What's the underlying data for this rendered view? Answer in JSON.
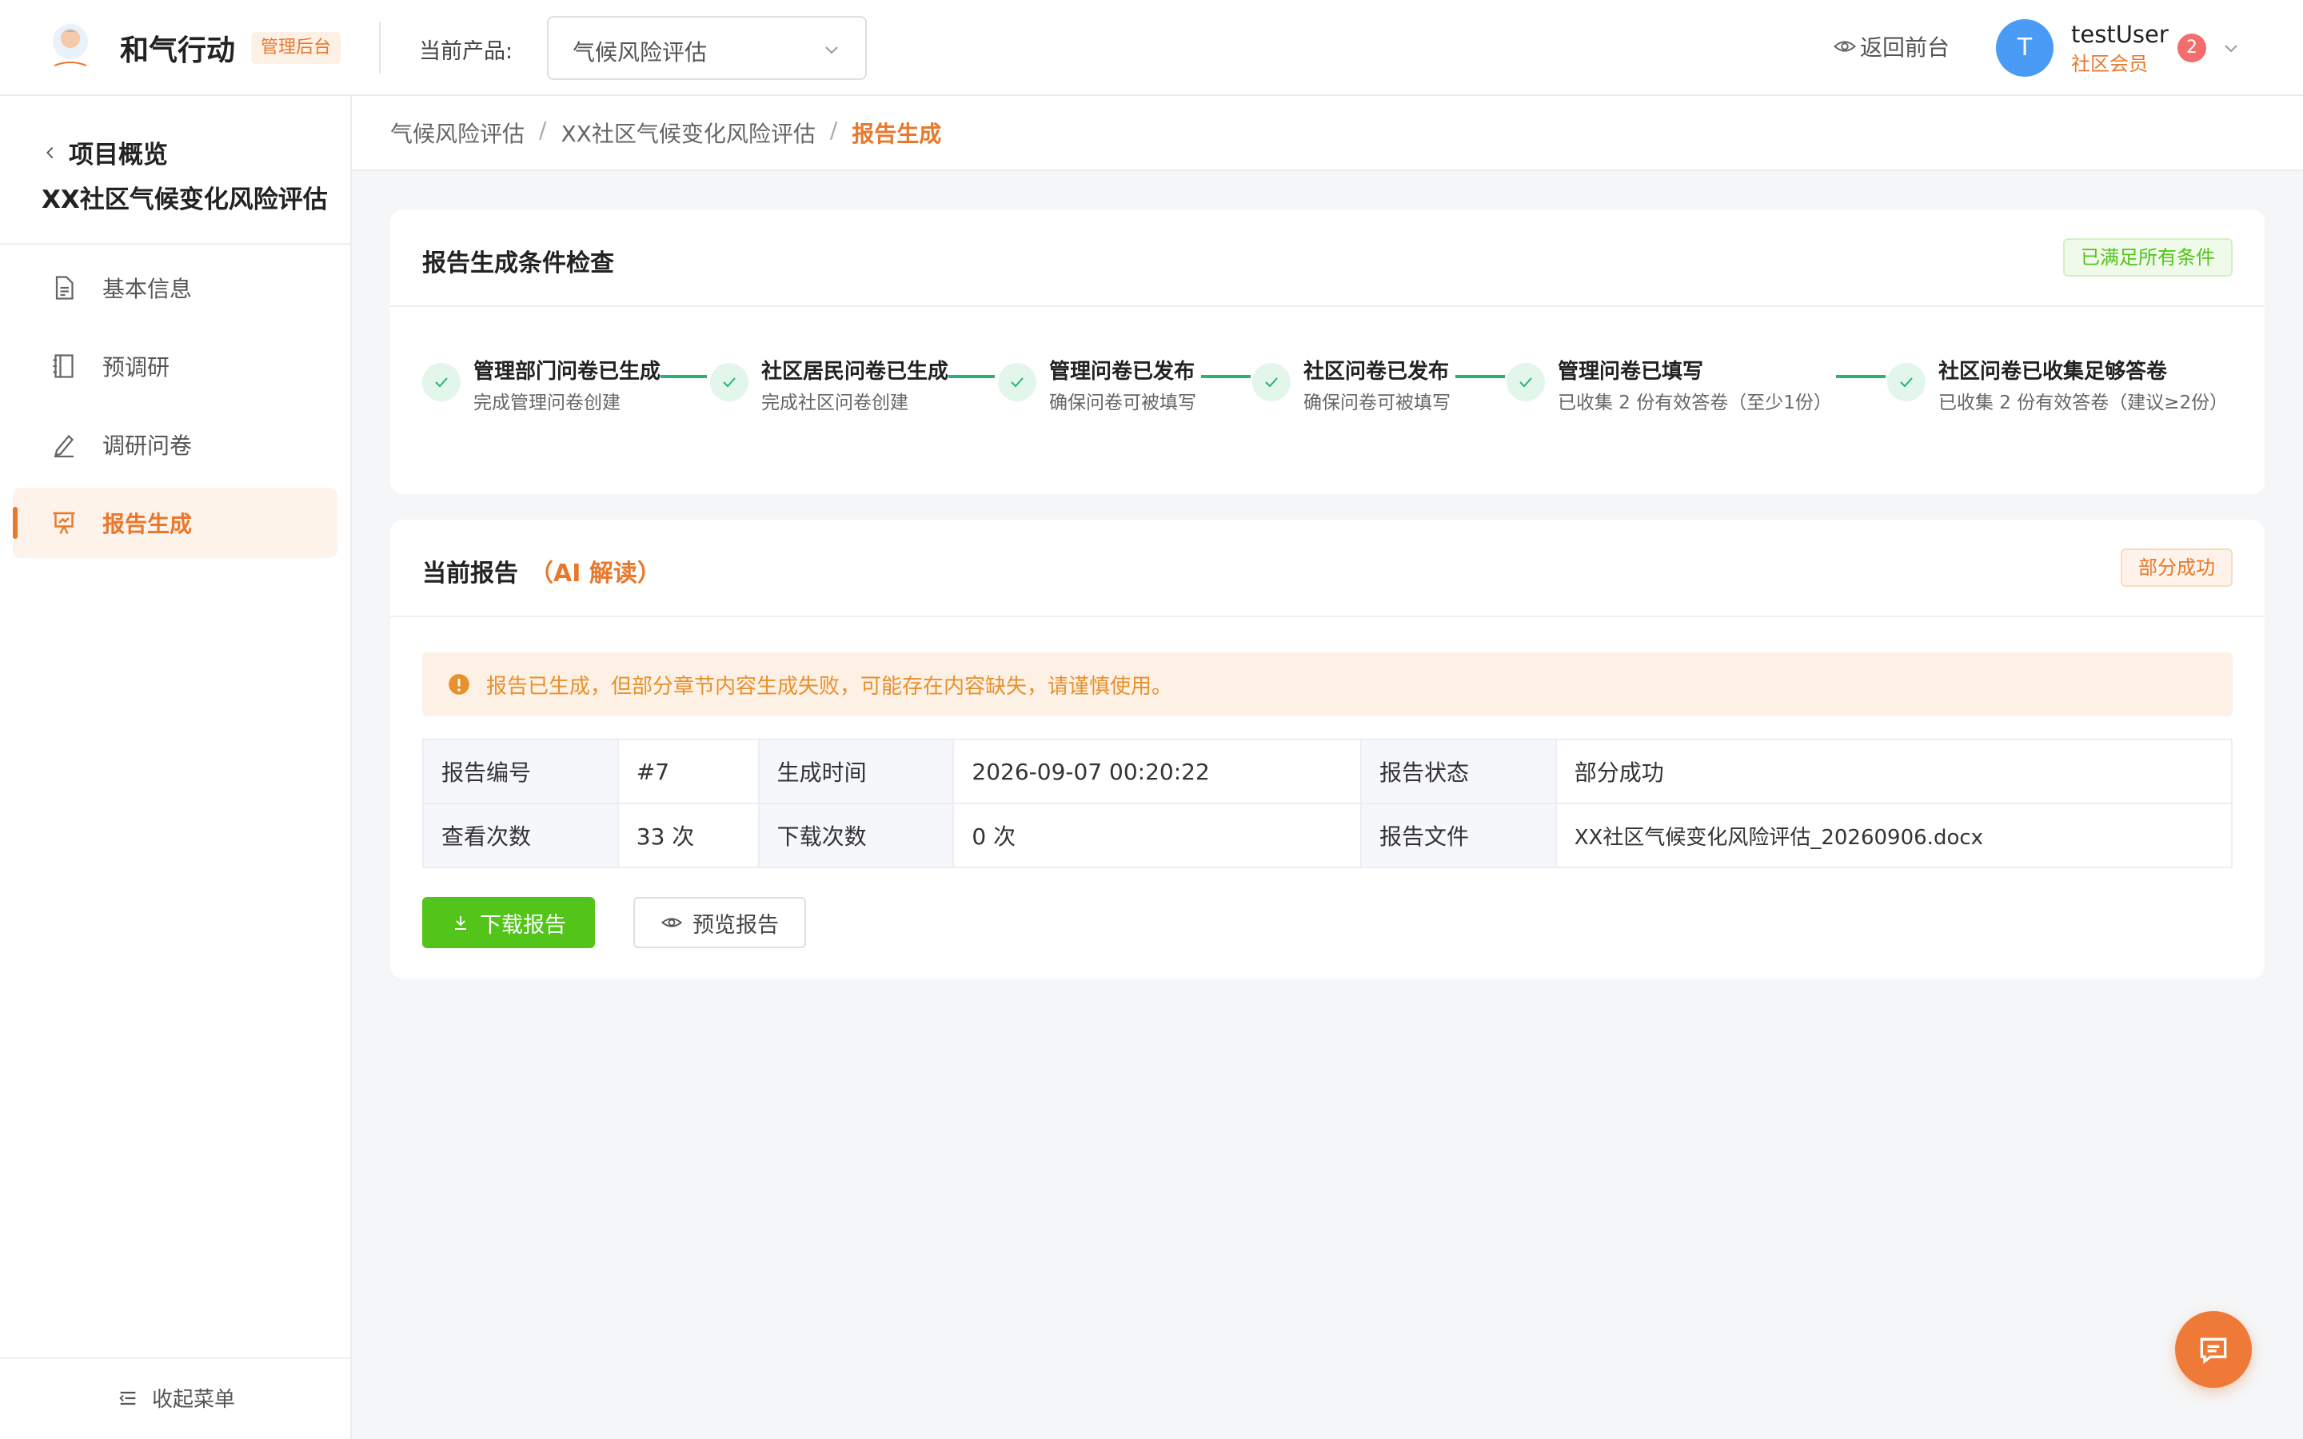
{
  "header": {
    "brand": "和气行动",
    "brand_tag": "管理后台",
    "product_label": "当前产品:",
    "product_value": "气候风险评估",
    "back_front": "返回前台",
    "user": {
      "avatar_letter": "T",
      "name": "testUser",
      "role": "社区会员",
      "notifications": "2"
    }
  },
  "sidebar": {
    "back_label": "项目概览",
    "project_name": "XX社区气候变化风险评估",
    "items": [
      {
        "label": "基本信息",
        "icon": "document-icon"
      },
      {
        "label": "预调研",
        "icon": "notebook-icon"
      },
      {
        "label": "调研问卷",
        "icon": "edit-icon"
      },
      {
        "label": "报告生成",
        "icon": "presentation-icon",
        "active": true
      }
    ],
    "collapse_label": "收起菜单"
  },
  "breadcrumb": {
    "items": [
      "气候风险评估",
      "XX社区气候变化风险评估",
      "报告生成"
    ]
  },
  "check_card": {
    "title": "报告生成条件检查",
    "status": "已满足所有条件",
    "steps": [
      {
        "title": "管理部门问卷已生成",
        "desc": "完成管理问卷创建"
      },
      {
        "title": "社区居民问卷已生成",
        "desc": "完成社区问卷创建"
      },
      {
        "title": "管理问卷已发布",
        "desc": "确保问卷可被填写"
      },
      {
        "title": "社区问卷已发布",
        "desc": "确保问卷可被填写"
      },
      {
        "title": "管理问卷已填写",
        "desc": "已收集 2 份有效答卷（至少1份）"
      },
      {
        "title": "社区问卷已收集足够答卷",
        "desc": "已收集 2 份有效答卷（建议≥2份）"
      }
    ]
  },
  "report_card": {
    "title": "当前报告",
    "title_suffix": "（AI 解读）",
    "status": "部分成功",
    "alert": "报告已生成，但部分章节内容生成失败，可能存在内容缺失，请谨慎使用。",
    "table": {
      "report_no_label": "报告编号",
      "report_no": "#7",
      "gen_time_label": "生成时间",
      "gen_time": "2026-09-07 00:20:22",
      "status_label": "报告状态",
      "status": "部分成功",
      "views_label": "查看次数",
      "views": "33 次",
      "downloads_label": "下载次数",
      "downloads": "0 次",
      "file_label": "报告文件",
      "file": "XX社区气候变化风险评估_20260906.docx"
    },
    "download_button": "下载报告",
    "preview_button": "预览报告"
  },
  "colors": {
    "accent": "#e8782c",
    "success": "#52c41a",
    "step_line": "#22b573"
  }
}
